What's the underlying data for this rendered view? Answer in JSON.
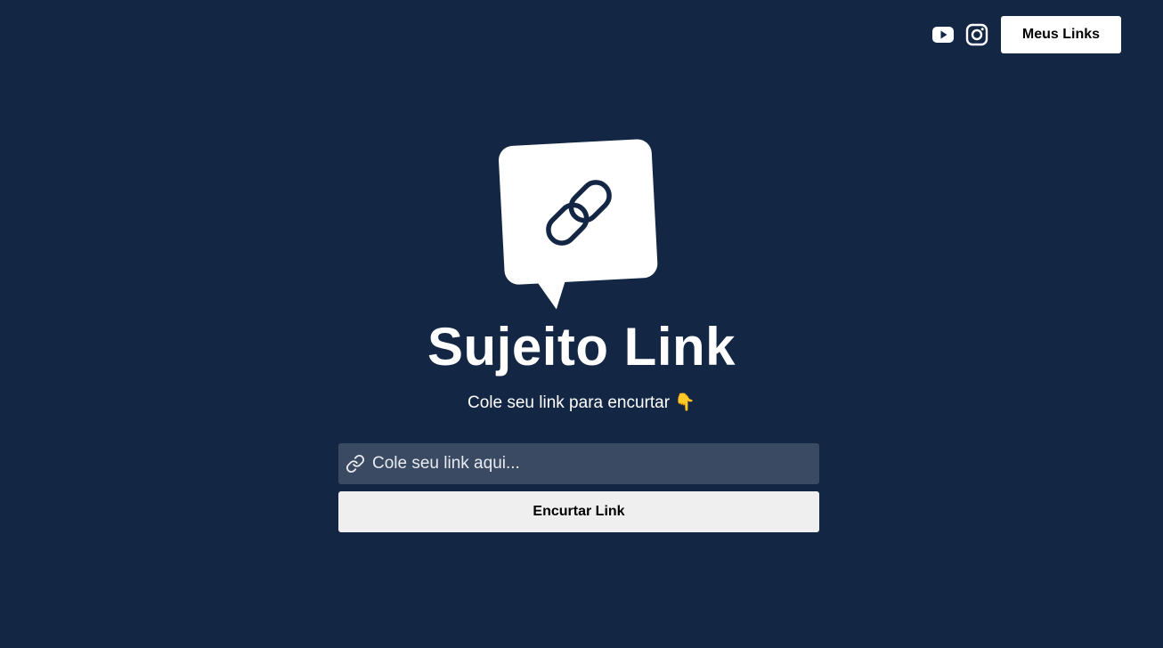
{
  "header": {
    "social": [
      {
        "icon": "youtube-icon"
      },
      {
        "icon": "instagram-icon"
      }
    ],
    "my_links_label": "Meus Links"
  },
  "logo": {
    "icon": "link-chat-bubble-icon"
  },
  "main": {
    "title": "Sujeito Link",
    "subtitle": "Cole seu link para encurtar 👇",
    "input": {
      "icon": "link-icon",
      "placeholder": "Cole seu link aqui...",
      "value": ""
    },
    "shorten_label": "Encurtar Link"
  },
  "colors": {
    "background": "#132644",
    "input_background": "#3a4a63",
    "button_background": "#efefef",
    "text": "#ffffff"
  }
}
